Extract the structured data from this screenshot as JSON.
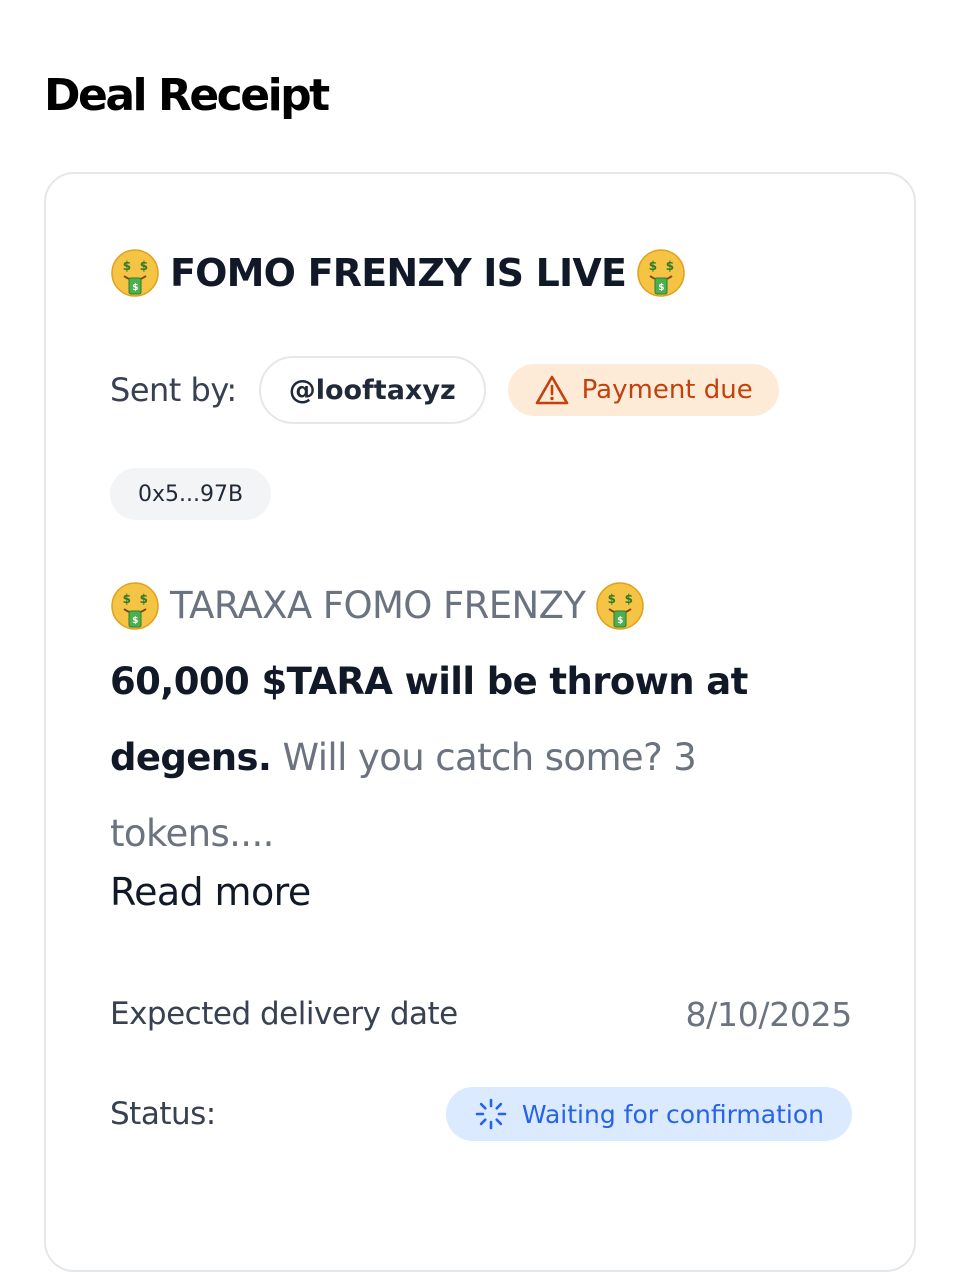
{
  "page": {
    "title": "Deal Receipt"
  },
  "deal": {
    "title_emoji": "money-mouth-face",
    "title": "FOMO FRENZY IS LIVE",
    "sent_by_label": "Sent by:",
    "sender": "@looftaxyz",
    "payment_badge": {
      "icon": "warning-triangle-icon",
      "label": "Payment due",
      "color": "#c2410c",
      "background": "#fdebd8"
    },
    "wallet_address": "0x5...97B",
    "description": {
      "lead": "TARAXA FOMO FRENZY",
      "bold_line_1": "60,000 $TARA will be thrown at",
      "bold_line_2": "degens.",
      "rest_line_2": " Will you catch some? 3",
      "line_3": "tokens...."
    },
    "read_more_label": "Read more",
    "delivery": {
      "label": "Expected delivery date",
      "value": "8/10/2025"
    },
    "status": {
      "label": "Status:",
      "icon": "spinner-icon",
      "value": "Waiting for confirmation",
      "color": "#2563eb",
      "background": "#dbeafe"
    }
  }
}
